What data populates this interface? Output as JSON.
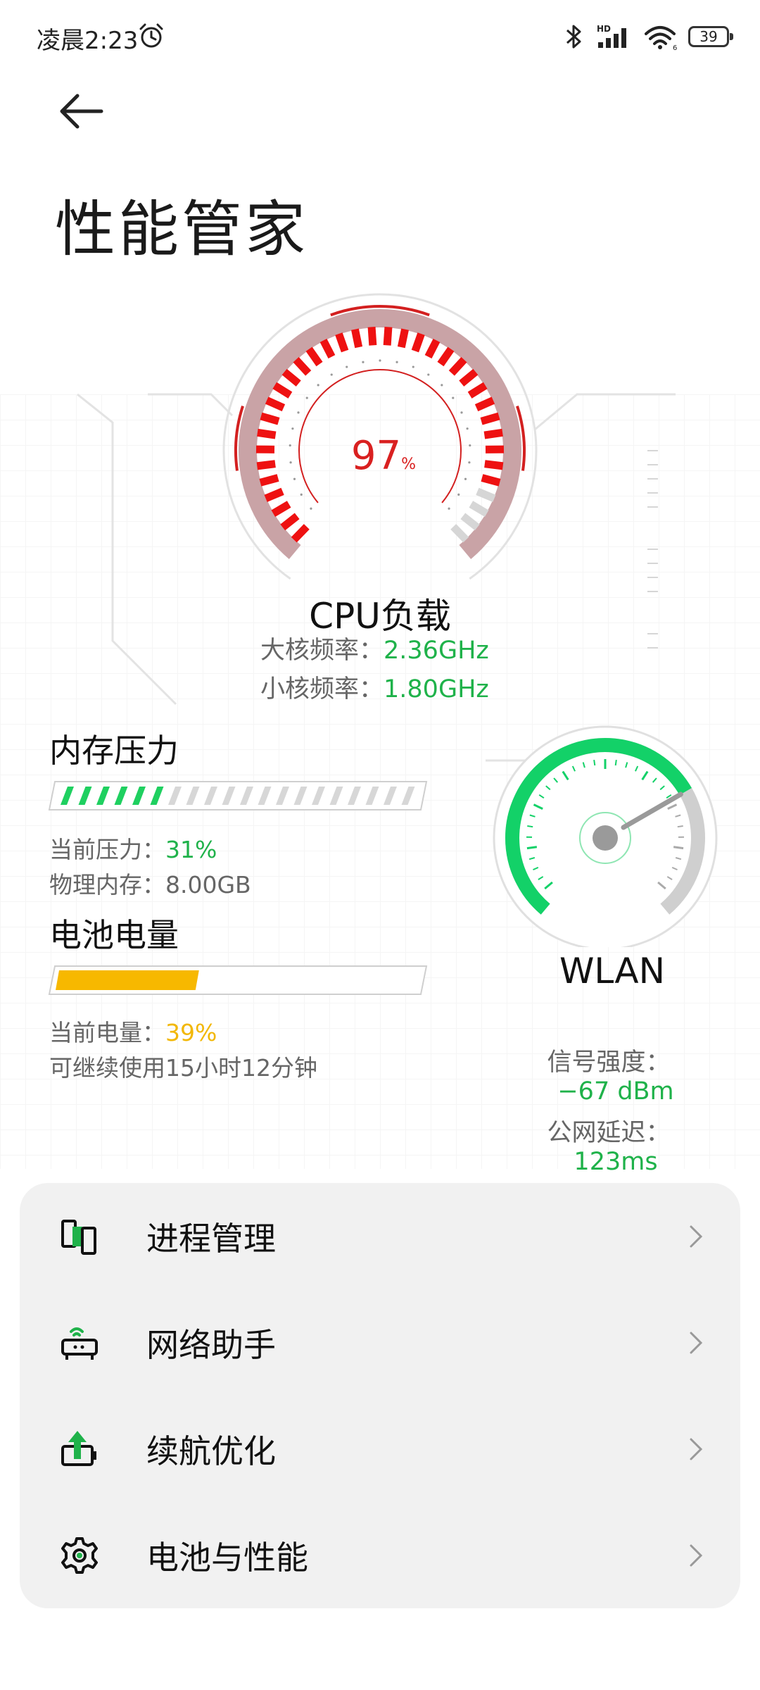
{
  "status_bar": {
    "time": "凌晨2:23",
    "hd": "HD",
    "wifi_label": "6",
    "battery": "39"
  },
  "header": {
    "title": "性能管家"
  },
  "cpu": {
    "value": "97",
    "unit": "%",
    "title": "CPU负载",
    "big_core_label": "大核频率：",
    "big_core_value": "2.36GHz",
    "small_core_label": "小核频率：",
    "small_core_value": "1.80GHz",
    "load_fraction": 0.97
  },
  "memory": {
    "title": "内存压力",
    "pressure_label": "当前压力：",
    "pressure_value": "31%",
    "physical_label": "物理内存：",
    "physical_value": "8.00GB",
    "fraction": 0.31
  },
  "battery": {
    "title": "电池电量",
    "level_label": "当前电量：",
    "level_value": "39%",
    "remaining": "可继续使用15小时12分钟",
    "fraction": 0.39
  },
  "wlan": {
    "title": "WLAN",
    "signal_label": "信号强度：",
    "signal_value": "−67 dBm",
    "latency_label": "公网延迟：",
    "latency_value": "123ms"
  },
  "menu": {
    "items": [
      {
        "label": "进程管理",
        "icon": "process-icon"
      },
      {
        "label": "网络助手",
        "icon": "router-icon"
      },
      {
        "label": "续航优化",
        "icon": "battery-boost-icon"
      },
      {
        "label": "电池与性能",
        "icon": "gear-icon"
      }
    ]
  },
  "colors": {
    "accent_green": "#1fb24a",
    "accent_red": "#d92020",
    "accent_yellow": "#f2b705"
  }
}
